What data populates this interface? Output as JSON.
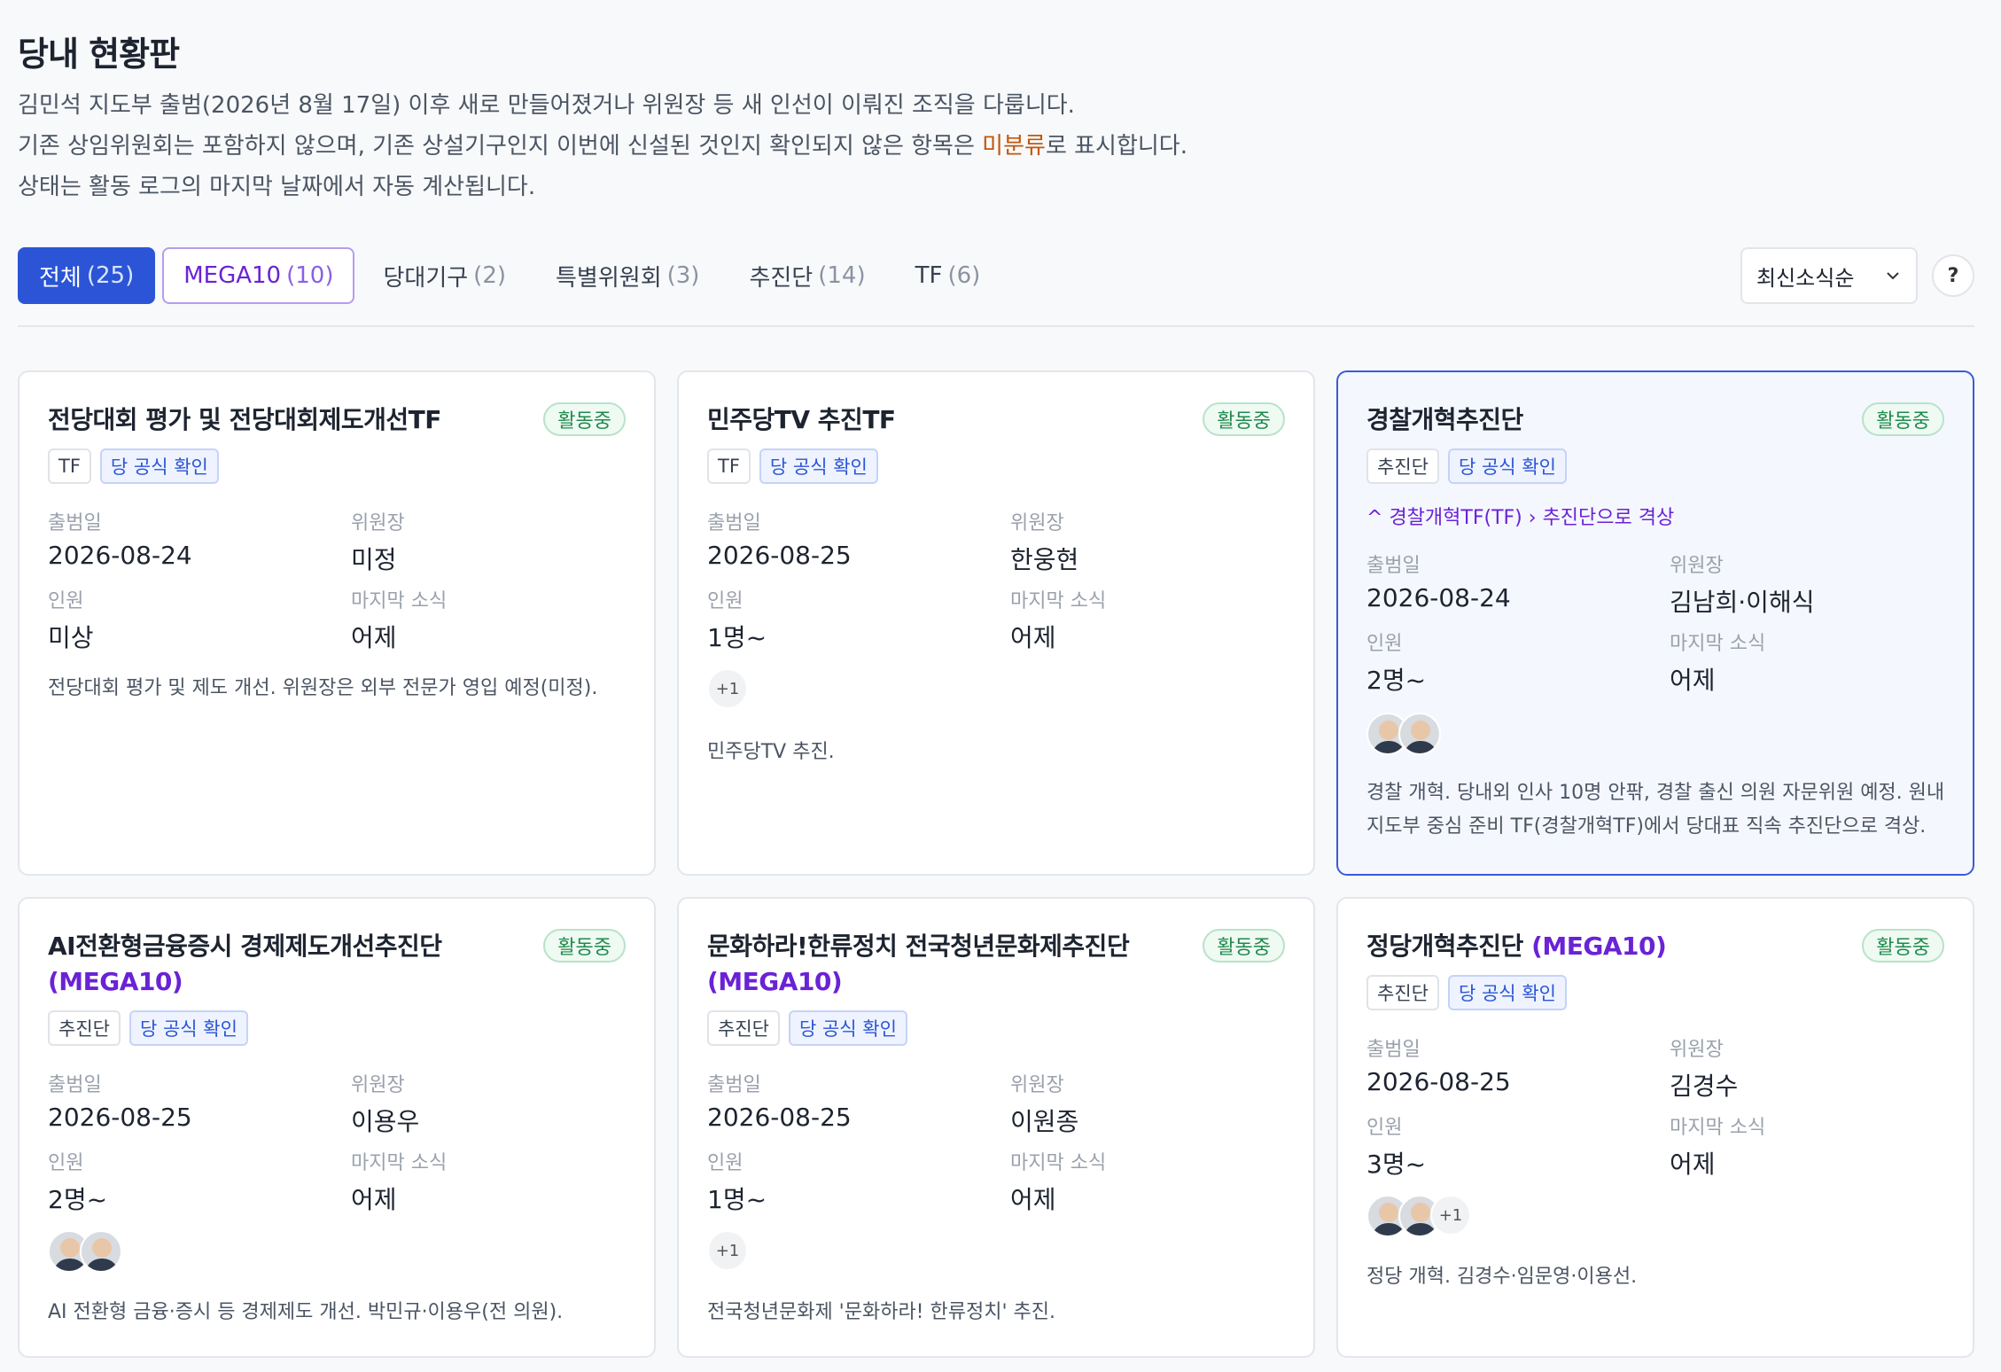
{
  "page": {
    "title": "당내 현황판",
    "desc1": "김민석 지도부 출범(2026년 8월 17일) 이후 새로 만들어졌거나 위원장 등 새 인선이 이뤄진 조직을 다룹니다.",
    "desc2a": "기존 상임위원회는 포함하지 않으며, 기존 상설기구인지 이번에 신설된 것인지 확인되지 않은 항목은 ",
    "desc2b": "미분류",
    "desc2c": "로 표시합니다.",
    "desc3": "상태는 활동 로그의 마지막 날짜에서 자동 계산됩니다."
  },
  "tabs": [
    {
      "label": "전체",
      "count": "(25)"
    },
    {
      "label": "MEGA10",
      "count": "(10)"
    },
    {
      "label": "당대기구",
      "count": "(2)"
    },
    {
      "label": "특별위원회",
      "count": "(3)"
    },
    {
      "label": "추진단",
      "count": "(14)"
    },
    {
      "label": "TF",
      "count": "(6)"
    }
  ],
  "sort": {
    "label": "최신소식순"
  },
  "help": {
    "label": "?"
  },
  "labels": {
    "start": "출범일",
    "chair": "위원장",
    "members": "인원",
    "last": "마지막 소식",
    "official": "당 공식 확인",
    "active": "활동중"
  },
  "cards": [
    {
      "title": "전당대회 평가 및 전당대회제도개선TF",
      "mega": "",
      "type": "TF",
      "start": "2026-08-24",
      "chair": "미정",
      "members": "미상",
      "last": "어제",
      "more": "",
      "note": "전당대회 평가 및 제도 개선. 위원장은 외부 전문가 영입 예정(미정)."
    },
    {
      "title": "민주당TV 추진TF",
      "mega": "",
      "type": "TF",
      "start": "2026-08-25",
      "chair": "한웅현",
      "members": "1명~",
      "last": "어제",
      "more": "+1",
      "note": "민주당TV 추진."
    },
    {
      "title": "경찰개혁추진단",
      "mega": "",
      "type": "추진단",
      "upgrade_from": "경찰개혁TF(TF)",
      "upgrade_to": "추진단으로 격상",
      "start": "2026-08-24",
      "chair": "김남희·이해식",
      "members": "2명~",
      "last": "어제",
      "more": "",
      "note1": "경찰 개혁. 당내외 인사 10명 안팎, 경찰 출신 의원 자문위원 예정. 원내",
      "note2": "지도부 중심 준비 TF(경찰개혁TF)에서 당대표 직속 추진단으로 격상."
    },
    {
      "title": "AI전환형금융증시 경제제도개선추진단",
      "mega": "(MEGA10)",
      "type": "추진단",
      "start": "2026-08-25",
      "chair": "이용우",
      "members": "2명~",
      "last": "어제",
      "more": "",
      "note": "AI 전환형 금융·증시 등 경제제도 개선. 박민규·이용우(전 의원)."
    },
    {
      "title": "문화하라!한류정치 전국청년문화제추진단",
      "mega": "(MEGA10)",
      "type": "추진단",
      "start": "2026-08-25",
      "chair": "이원종",
      "members": "1명~",
      "last": "어제",
      "more": "+1",
      "note": "전국청년문화제 '문화하라! 한류정치' 추진."
    },
    {
      "title": "정당개혁추진단",
      "mega": "(MEGA10)",
      "type": "추진단",
      "start": "2026-08-25",
      "chair": "김경수",
      "members": "3명~",
      "last": "어제",
      "more": "+1",
      "note": "정당 개혁. 김경수·임문영·이용선."
    }
  ]
}
